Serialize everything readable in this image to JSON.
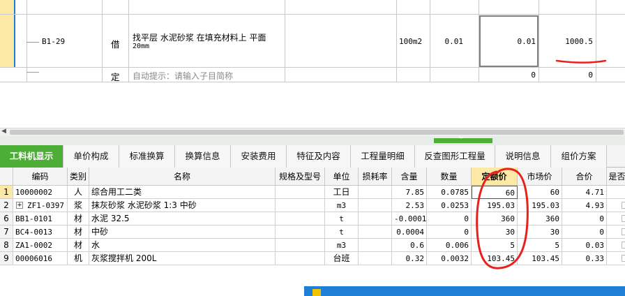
{
  "top_rows": [
    {
      "code": "B1-29",
      "type": "借",
      "name_line1": "找平层 水泥砂浆 在填充材料上 平面",
      "name_line2": "20mm",
      "unit": "100m2",
      "content": "0.01",
      "quantity": "0.01",
      "price": "1000.5"
    },
    {
      "code": "",
      "type": "定",
      "name_placeholder": "自动提示：请输入子目简称",
      "quantity": "0",
      "price": "0"
    }
  ],
  "scrollbar": {
    "left_arrow": "◀"
  },
  "tabs": [
    "工料机显示",
    "单价构成",
    "标准换算",
    "换算信息",
    "安装费用",
    "特征及内容",
    "工程量明细",
    "反查图形工程量",
    "说明信息",
    "组价方案"
  ],
  "columns": [
    "编码",
    "类别",
    "名称",
    "规格及型号",
    "单位",
    "损耗率",
    "含量",
    "数量",
    "定额价",
    "市场价",
    "合价",
    "是否"
  ],
  "rows": [
    {
      "num": "1",
      "code": "10000002",
      "cat": "人",
      "name": "综合用工二类",
      "unit": "工日",
      "content": "7.85",
      "qty": "0.0785",
      "quota": "60",
      "market": "60",
      "total": "4.71",
      "expand": ""
    },
    {
      "num": "2",
      "code": "ZF1-0397",
      "cat": "浆",
      "name": "抹灰砂浆 水泥砂浆 1:3 中砂",
      "unit": "m3",
      "content": "2.53",
      "qty": "0.0253",
      "quota": "195.03",
      "market": "195.03",
      "total": "4.93",
      "expand": "+"
    },
    {
      "num": "6",
      "code": "BB1-0101",
      "cat": "材",
      "name": "水泥 32.5",
      "unit": "t",
      "content": "-0.0001",
      "qty": "0",
      "quota": "360",
      "market": "360",
      "total": "0",
      "expand": ""
    },
    {
      "num": "7",
      "code": "BC4-0013",
      "cat": "材",
      "name": "中砂",
      "unit": "t",
      "content": "0.0004",
      "qty": "0",
      "quota": "30",
      "market": "30",
      "total": "0",
      "expand": ""
    },
    {
      "num": "8",
      "code": "ZA1-0002",
      "cat": "材",
      "name": "水",
      "unit": "m3",
      "content": "0.6",
      "qty": "0.006",
      "quota": "5",
      "market": "5",
      "total": "0.03",
      "expand": ""
    },
    {
      "num": "9",
      "code": "00006016",
      "cat": "机",
      "name": "灰浆搅拌机 200L",
      "unit": "台班",
      "content": "0.32",
      "qty": "0.0032",
      "quota": "103.45",
      "market": "103.45",
      "total": "0.33",
      "expand": ""
    }
  ],
  "colors": {
    "active_tab": "#4cae34",
    "highlight_header": "#fde9a6",
    "annotation": "#e8201e",
    "popup_bar": "#1e7fd6"
  }
}
